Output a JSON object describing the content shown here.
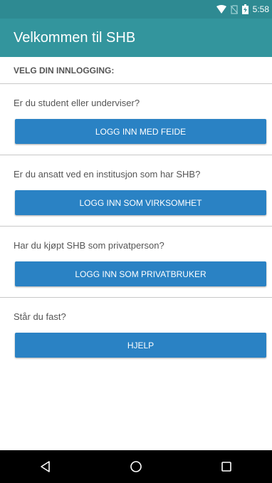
{
  "status_bar": {
    "time": "5:58"
  },
  "app_bar": {
    "title": "Velkommen til SHB"
  },
  "section_title": "VELG DIN INNLOGGING:",
  "options": [
    {
      "question": "Er du student eller underviser?",
      "button": "LOGG INN MED FEIDE"
    },
    {
      "question": "Er du ansatt ved en institusjon som har SHB?",
      "button": "LOGG INN SOM VIRKSOMHET"
    },
    {
      "question": "Har du kjøpt SHB som privatperson?",
      "button": "LOGG INN SOM PRIVATBRUKER"
    },
    {
      "question": "Står du fast?",
      "button": "HJELP"
    }
  ],
  "colors": {
    "status_bar": "#2e8a92",
    "app_bar": "#33959d",
    "button": "#2a82c4",
    "nav_bar": "#000000"
  },
  "icons": {
    "status": [
      "wifi-icon",
      "no-sim-icon",
      "battery-charging-icon"
    ],
    "nav": [
      "back-icon",
      "home-icon",
      "recents-icon"
    ]
  }
}
